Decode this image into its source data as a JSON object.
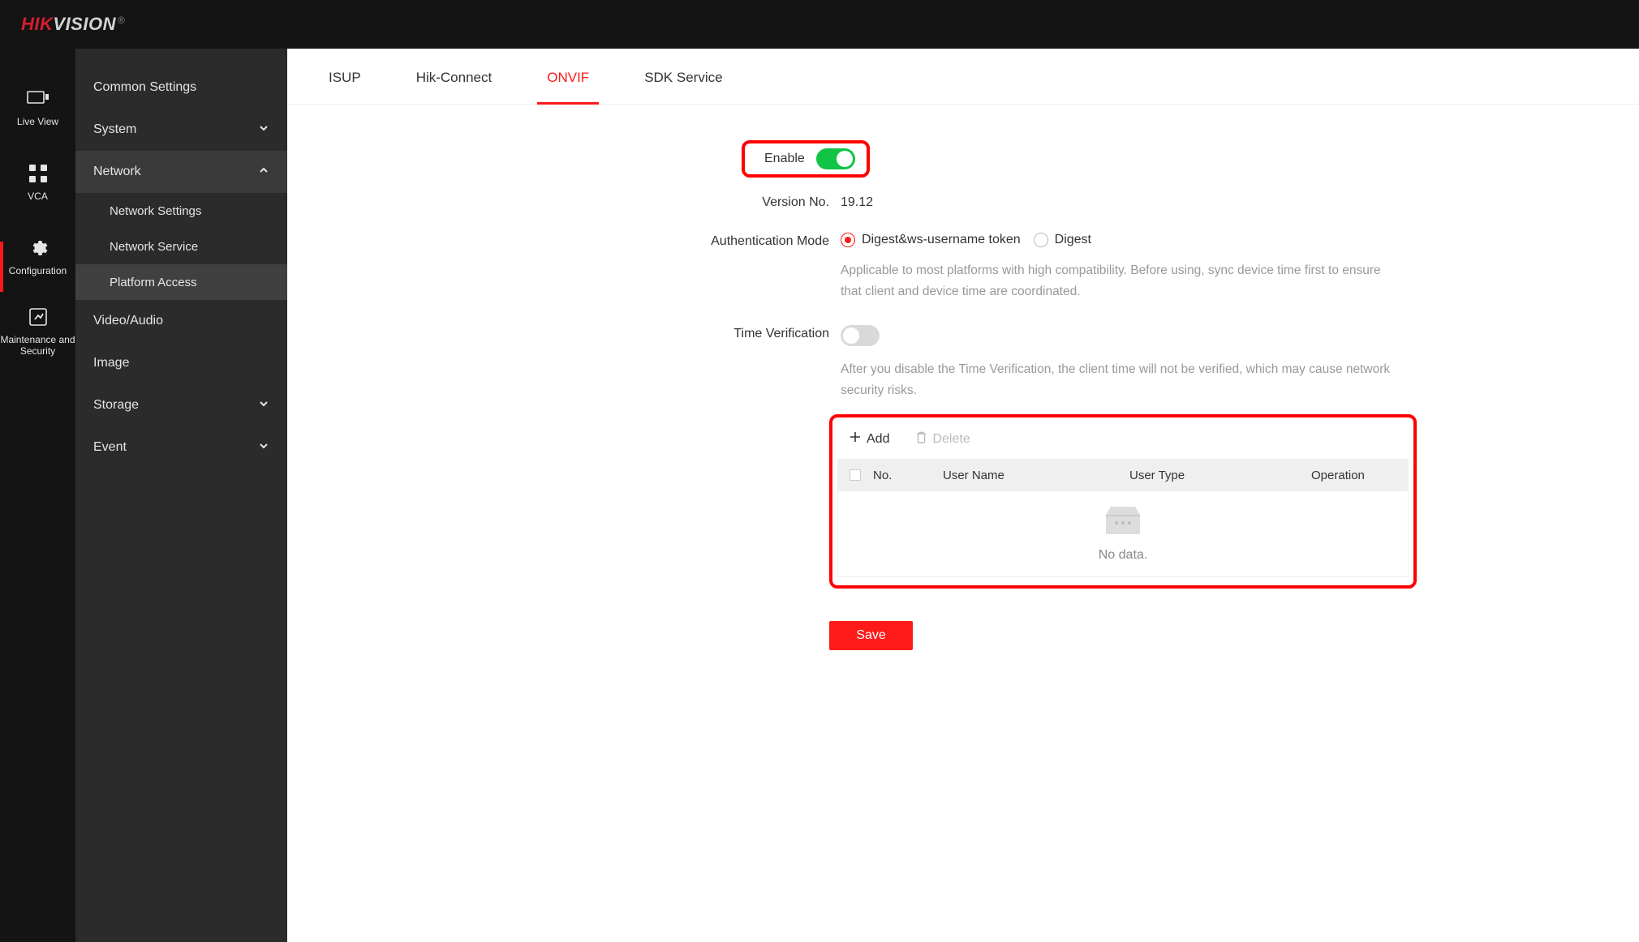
{
  "logo": {
    "part1": "HIK",
    "part2": "VISION",
    "reg": "®"
  },
  "primaryNav": [
    {
      "label": "Live View",
      "icon": "liveview"
    },
    {
      "label": "VCA",
      "icon": "vca"
    },
    {
      "label": "Configuration",
      "icon": "gear",
      "active": true
    },
    {
      "label": "Maintenance and Security",
      "icon": "maintenance"
    }
  ],
  "secondaryNav": {
    "commonSettings": "Common Settings",
    "system": "System",
    "network": "Network",
    "networkChildren": [
      {
        "label": "Network Settings"
      },
      {
        "label": "Network Service"
      },
      {
        "label": "Platform Access",
        "active": true
      }
    ],
    "videoAudio": "Video/Audio",
    "image": "Image",
    "storage": "Storage",
    "event": "Event"
  },
  "tabs": [
    {
      "label": "ISUP"
    },
    {
      "label": "Hik-Connect"
    },
    {
      "label": "ONVIF",
      "active": true
    },
    {
      "label": "SDK Service"
    }
  ],
  "form": {
    "enable": {
      "label": "Enable",
      "on": true
    },
    "version": {
      "label": "Version No.",
      "value": "19.12"
    },
    "auth": {
      "label": "Authentication Mode",
      "option1": "Digest&ws-username token",
      "option2": "Digest",
      "hint": "Applicable to most platforms with high compatibility. Before using, sync device time first to ensure that client and device time are coordinated."
    },
    "timeVerify": {
      "label": "Time Verification",
      "on": false,
      "hint": "After you disable the Time Verification, the client time will not be verified, which may cause network security risks."
    }
  },
  "userTable": {
    "add": "Add",
    "delete": "Delete",
    "cols": {
      "no": "No.",
      "user": "User Name",
      "type": "User Type",
      "op": "Operation"
    },
    "empty": "No data."
  },
  "save": "Save"
}
